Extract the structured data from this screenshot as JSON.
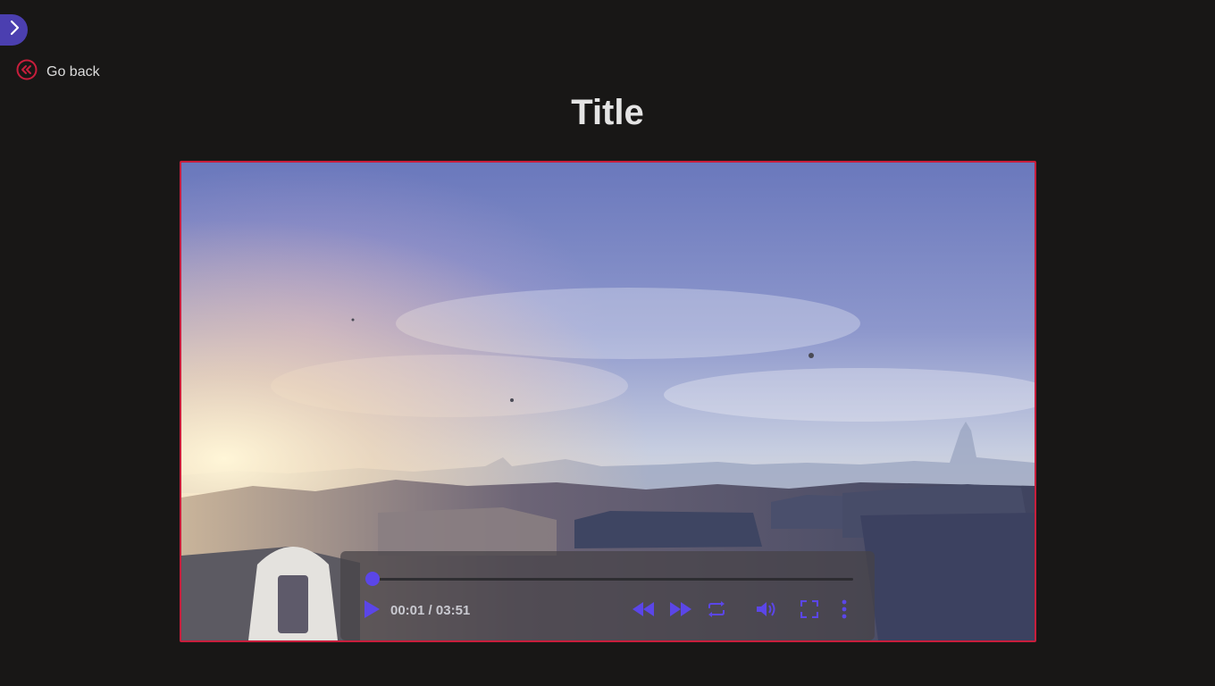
{
  "nav": {
    "back_label": "Go back",
    "toggle_icon": "chevron-right-icon",
    "back_icon": "double-chevron-left-circle-icon"
  },
  "page": {
    "title": "Title"
  },
  "player": {
    "current_time": "00:01",
    "separator": " / ",
    "duration": "03:51",
    "progress_fraction": 0.004,
    "accent_color": "#5b46e8",
    "border_color": "#c81e3c",
    "controls": {
      "play_icon": "play-icon",
      "rewind_icon": "rewind-icon",
      "fast_forward_icon": "fast-forward-icon",
      "loop_icon": "loop-icon",
      "volume_icon": "volume-icon",
      "fullscreen_icon": "fullscreen-icon",
      "more_icon": "more-vertical-icon"
    }
  },
  "colors": {
    "background": "#181716",
    "toggle_bg": "#4b3fb0",
    "back_icon": "#c81e3c"
  }
}
